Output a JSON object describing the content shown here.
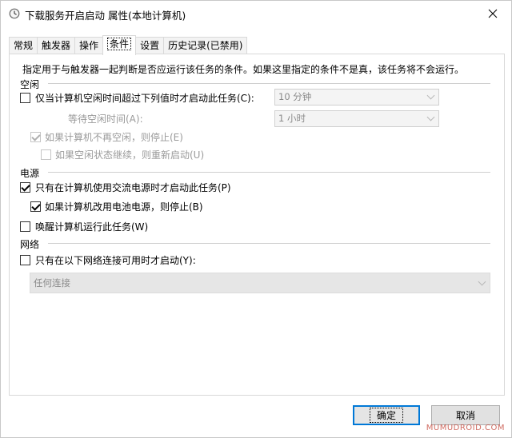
{
  "window": {
    "title": "下载服务开启启动 属性(本地计算机)",
    "icon": "clock-icon",
    "close": "×"
  },
  "tabs": [
    {
      "label": "常规",
      "active": false
    },
    {
      "label": "触发器",
      "active": false
    },
    {
      "label": "操作",
      "active": false
    },
    {
      "label": "条件",
      "active": true
    },
    {
      "label": "设置",
      "active": false
    },
    {
      "label": "历史记录(已禁用)",
      "active": false
    }
  ],
  "conditions": {
    "intro": "指定用于与触发器一起判断是否应运行该任务的条件。如果这里指定的条件不是真，该任务将不会运行。",
    "idle": {
      "section": "空闲",
      "start_idle": {
        "label": "仅当计算机空闲时间超过下列值时才启动此任务(C):",
        "checked": false
      },
      "idle_duration": "10 分钟",
      "wait_label": "等待空闲时间(A):",
      "wait_value": "1 小时",
      "stop_on_idle_end": {
        "label": "如果计算机不再空闲，则停止(E)",
        "checked": true,
        "disabled": true
      },
      "restart_on_idle": {
        "label": "如果空闲状态继续，则重新启动(U)",
        "checked": false,
        "disabled": true
      }
    },
    "power": {
      "section": "电源",
      "ac_only": {
        "label": "只有在计算机使用交流电源时才启动此任务(P)",
        "checked": true
      },
      "stop_on_battery": {
        "label": "如果计算机改用电池电源，则停止(B)",
        "checked": true
      },
      "wake": {
        "label": "唤醒计算机运行此任务(W)",
        "checked": false
      }
    },
    "network": {
      "section": "网络",
      "network_only": {
        "label": "只有在以下网络连接可用时才启动(Y):",
        "checked": false
      },
      "connection": "任何连接"
    }
  },
  "buttons": {
    "ok": "确定",
    "cancel": "取消"
  },
  "watermark": "MUMUDROID.COM",
  "colors": {
    "accent": "#0078d7",
    "disabled_text": "#9a9a9a",
    "watermark": "#c0392b"
  }
}
